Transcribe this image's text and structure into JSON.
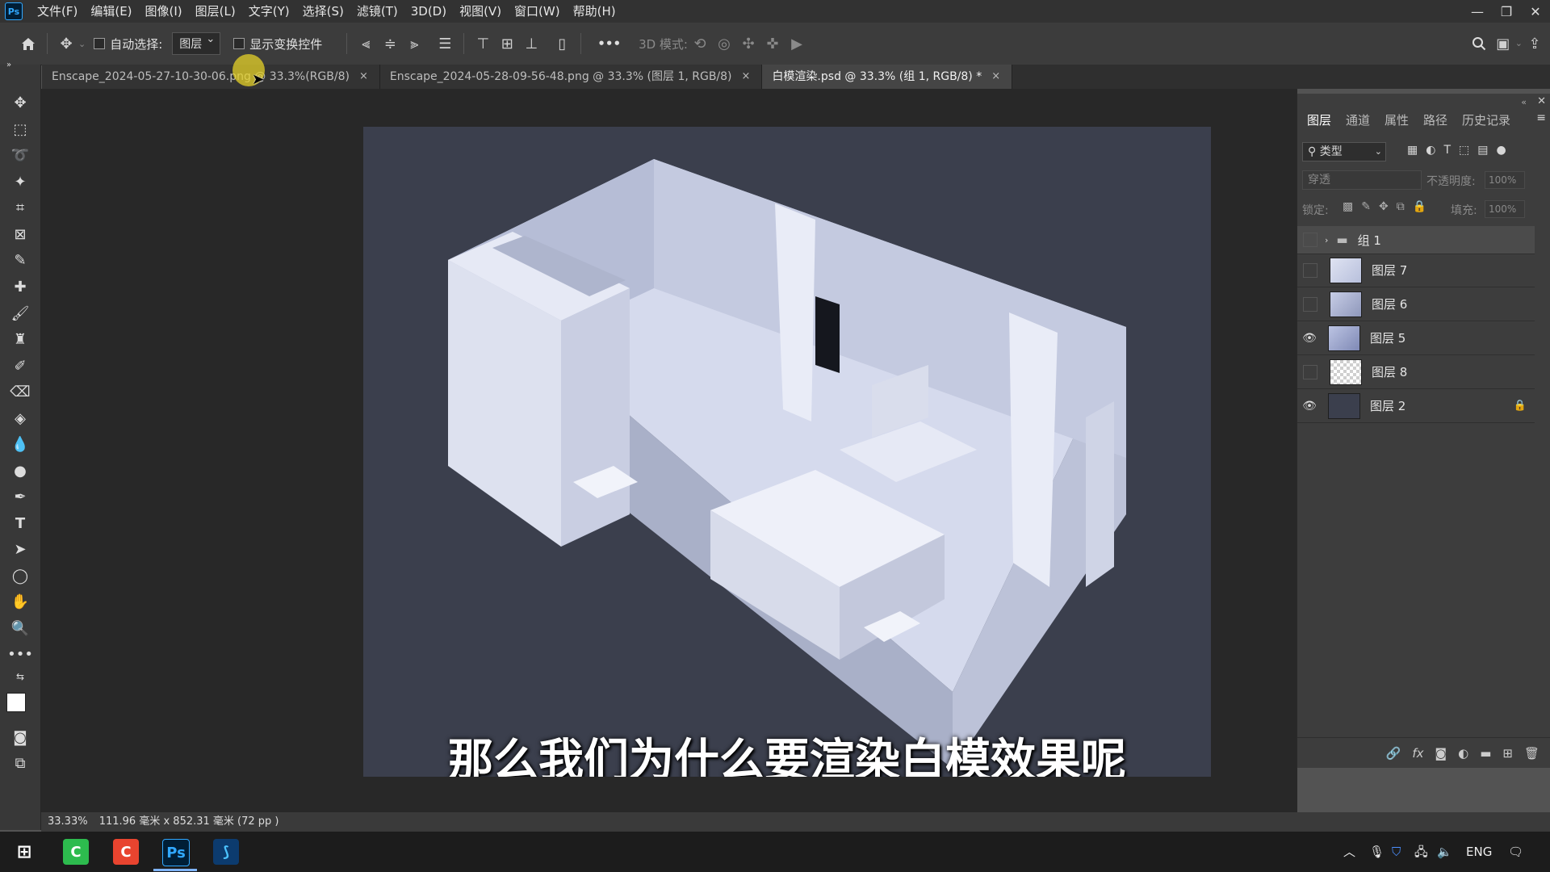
{
  "app": {
    "logo": "Ps"
  },
  "menu": [
    "文件(F)",
    "编辑(E)",
    "图像(I)",
    "图层(L)",
    "文字(Y)",
    "选择(S)",
    "滤镜(T)",
    "3D(D)",
    "视图(V)",
    "窗口(W)",
    "帮助(H)"
  ],
  "options": {
    "auto_select_label": "自动选择:",
    "auto_select_value": "图层",
    "show_transform_label": "显示变换控件",
    "more": "•••",
    "mode_3d_label": "3D 模式:"
  },
  "tabs": [
    {
      "title": "Enscape_2024-05-27-10-30-06.png @ 33.3%(RGB/8)",
      "active": false
    },
    {
      "title": "Enscape_2024-05-28-09-56-48.png @ 33.3% (图层 1, RGB/8)",
      "active": false
    },
    {
      "title": "白模渲染.psd @ 33.3% (组 1, RGB/8) *",
      "active": true
    }
  ],
  "tab_close": "×",
  "canvas": {
    "subtitle": "那么我们为什么要渲染白模效果呢"
  },
  "layers_panel": {
    "tabs": [
      "图层",
      "通道",
      "属性",
      "路径",
      "历史记录"
    ],
    "filter_kind": "类型",
    "blend_mode": "穿透",
    "opacity_label": "不透明度:",
    "opacity_value": "100%",
    "lock_label": "锁定:",
    "fill_label": "填充:",
    "fill_value": "100%",
    "layers": [
      {
        "name": "组 1",
        "visible": false,
        "type": "group",
        "selected": true
      },
      {
        "name": "图层 7",
        "visible": false,
        "type": "image"
      },
      {
        "name": "图层 6",
        "visible": false,
        "type": "image"
      },
      {
        "name": "图层 5",
        "visible": true,
        "type": "image"
      },
      {
        "name": "图层 8",
        "visible": false,
        "type": "transparent"
      },
      {
        "name": "图层 2",
        "visible": true,
        "type": "solid",
        "locked": true
      }
    ],
    "footer_fx": "fx"
  },
  "status": {
    "zoom": "33.33%",
    "doc_size": "111.96 毫米 x 852.31 毫米 (72 pp )"
  },
  "taskbar": {
    "lang": "ENG",
    "ps_label": "Ps"
  },
  "colors": {
    "accent": "#31a8ff",
    "canvas_bg": "#3b3f4d",
    "highlight": "#e6d228"
  }
}
